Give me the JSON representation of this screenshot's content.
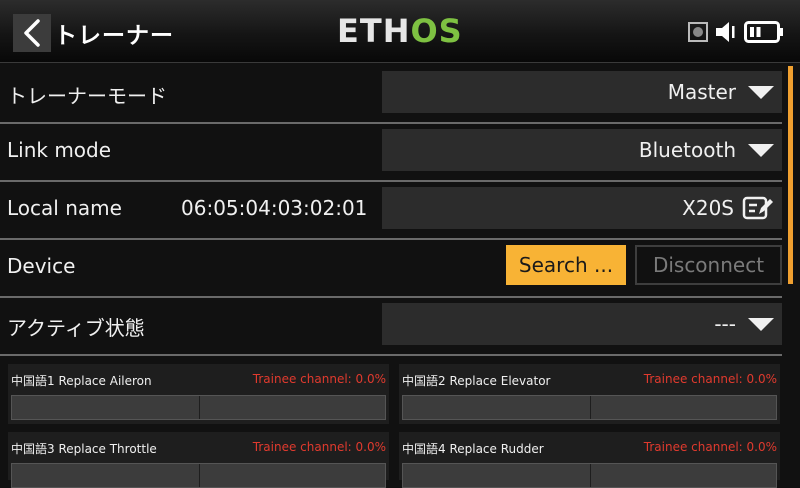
{
  "header": {
    "title": "トレーナー",
    "logo_part1": "ETH",
    "logo_part2": "OS"
  },
  "rows": {
    "trainer_mode": {
      "label": "トレーナーモード",
      "value": "Master"
    },
    "link_mode": {
      "label": "Link mode",
      "value": "Bluetooth"
    },
    "local_name": {
      "label": "Local name",
      "mac": "06:05:04:03:02:01",
      "value": "X20S"
    },
    "device": {
      "label": "Device",
      "search_label": "Search ...",
      "disconnect_label": "Disconnect"
    },
    "active_state": {
      "label": "アクティブ状態",
      "value": "---"
    }
  },
  "channels": [
    {
      "title": "中国語1 Replace Aileron",
      "status": "Trainee channel: 0.0%"
    },
    {
      "title": "中国語2 Replace Elevator",
      "status": "Trainee channel: 0.0%"
    },
    {
      "title": "中国語3 Replace Throttle",
      "status": "Trainee channel: 0.0%"
    },
    {
      "title": "中国語4 Replace Rudder",
      "status": "Trainee channel: 0.0%"
    }
  ],
  "colors": {
    "accent": "#f8b335",
    "logo_green": "#7ec142",
    "warning_text": "#e03a2e"
  }
}
